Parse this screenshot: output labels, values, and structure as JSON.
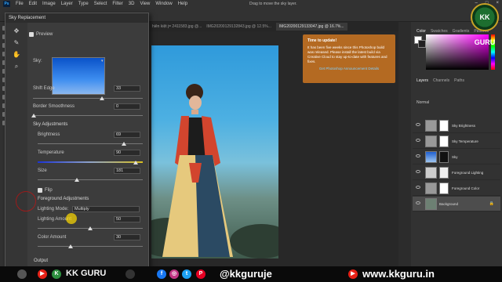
{
  "menubar": {
    "app_icon": "Ps",
    "items": [
      "File",
      "Edit",
      "Image",
      "Layer",
      "Type",
      "Select",
      "Filter",
      "3D",
      "View",
      "Window",
      "Help"
    ],
    "hint": "Drag to move the sky layer."
  },
  "doc_tabs": [
    "hiên kiệt j= 2411583.jpg @...",
    "IMG20200129132843.jpg @ 12.5%...",
    "IMG20200129133047.jpg @ 16.7%..."
  ],
  "dialog": {
    "title": "Sky Replacement",
    "preview_label": "Preview",
    "sky_label": "Sky:",
    "shift_edge": {
      "label": "Shift Edge",
      "value": "33",
      "level": 0.55
    },
    "border_smoothness": {
      "label": "Border Smoothness",
      "value": "0",
      "level": 0.0
    },
    "sky_adjustments": "Sky Adjustments",
    "brightness": {
      "label": "Brightness",
      "value": "69",
      "level": 0.69
    },
    "temperature": {
      "label": "Temperature",
      "value": "90",
      "level": 0.95
    },
    "size": {
      "label": "Size",
      "value": "181",
      "level": 0.8
    },
    "flip": "Flip",
    "foreground_adjustments": "Foreground Adjustments",
    "lighting_mode": {
      "label": "Lighting Mode:",
      "value": "Multiply"
    },
    "lighting_amount": {
      "label": "Lighting Amount",
      "value": "50",
      "level": 0.5
    },
    "color_amount": {
      "label": "Color Amount",
      "value": "30",
      "level": 0.3
    },
    "output": "Output"
  },
  "notification": {
    "title": "Time to update!",
    "body": "It has been five weeks since this Photoshop build was released. Please install the latest build via Creative Cloud to stay up-to-date with features and fixes.",
    "link": "Get Photoshop Announcement Details"
  },
  "color_panel": {
    "tabs": [
      "Color",
      "Swatches",
      "Gradients",
      "Patterns"
    ]
  },
  "layers_panel": {
    "tabs": [
      "Layers",
      "Channels",
      "Paths"
    ],
    "blend_mode": "Normal",
    "layers": [
      {
        "name": "Sky Brightness"
      },
      {
        "name": "Sky Temperature"
      },
      {
        "name": "Sky"
      },
      {
        "name": "Foreground Lighting"
      },
      {
        "name": "Foreground Color"
      },
      {
        "name": "Background"
      }
    ]
  },
  "channel": {
    "brand": "KK GURU",
    "handle": "@kkguruje",
    "site": "www.kkguru.in",
    "logo": "KK GURU"
  },
  "colors": {
    "accent": "#31a8ff",
    "notification": "#b46a22",
    "bottombar": "#0a0a0a"
  }
}
